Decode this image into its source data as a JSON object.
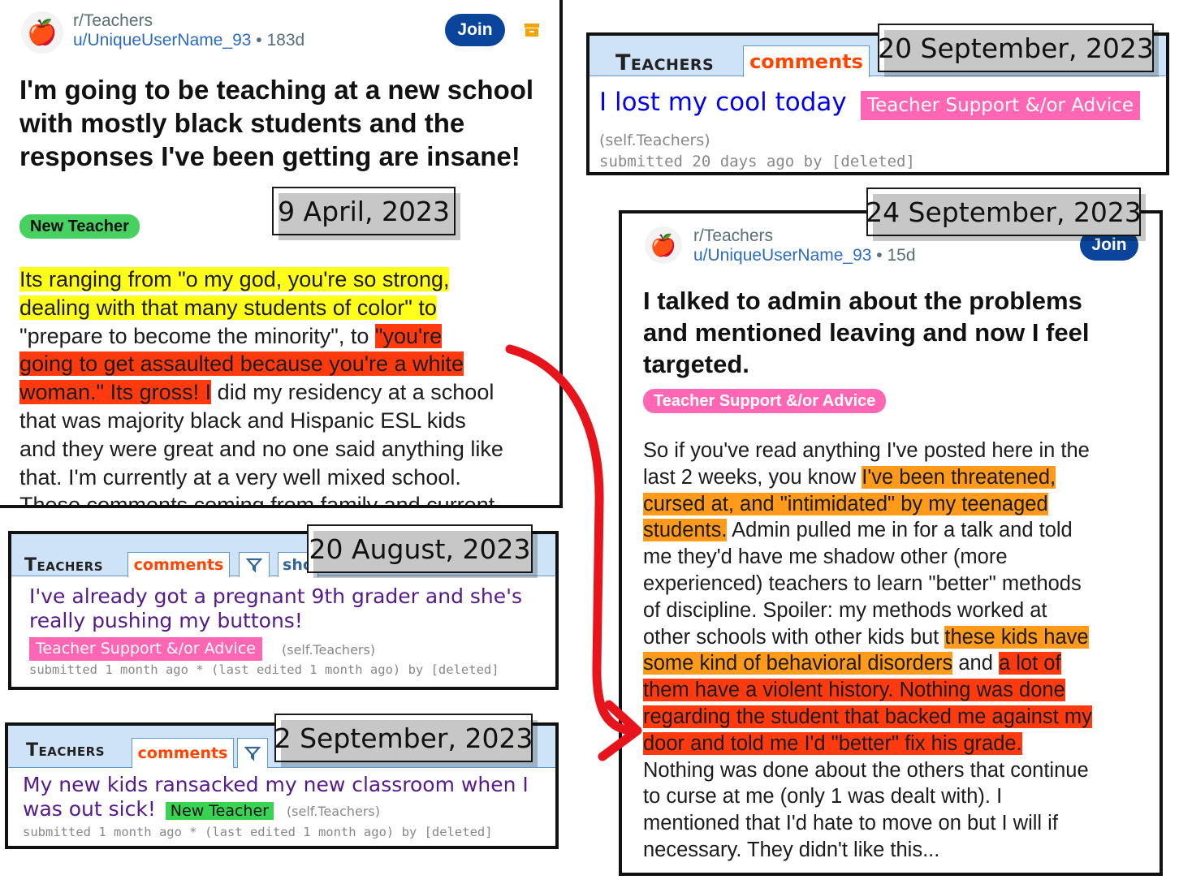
{
  "dates": {
    "d1": "9 April, 2023",
    "d2": "20 September, 2023",
    "d3": "24 September, 2023",
    "d4": "20 August, 2023",
    "d5": "2 September, 2023"
  },
  "post1": {
    "subreddit": "r/Teachers",
    "username": "u/UniqueUserName_93",
    "separator": " • ",
    "age": "183d",
    "join": "Join",
    "title": "I'm going to be teaching at a new school with mostly black students and the responses I've been getting are insane!",
    "flair": "New Teacher",
    "body": {
      "y1": "Its ranging from \"o my god, you're so strong,",
      "y2": "dealing with that many students of color\" to",
      "p3": "\"prepare to become the minority\", to ",
      "r1": "\"you're",
      "r2": "going to get assaulted because you're a white",
      "r3": "woman.\" Its gross! I",
      "p4": " did my residency at a school",
      "p5": "that was majority black and Hispanic ESL kids",
      "p6": "and they were great and no one said anything like",
      "p7": "that. I'm currently at a very well mixed school.",
      "p8": "These comments coming from family and current"
    }
  },
  "post2": {
    "logo": "Teachers",
    "tab": "comments",
    "title": "I lost my cool today",
    "flair": "Teacher Support &/or Advice",
    "domain": "(self.Teachers)",
    "meta": "submitted 20 days ago by [deleted]"
  },
  "post3": {
    "subreddit": "r/Teachers",
    "username": "u/UniqueUserName_93",
    "separator": " • ",
    "age": "15d",
    "join": "Join",
    "title": "I talked to admin about the problems and mentioned leaving and now I feel targeted.",
    "flair": "Teacher Support &/or Advice",
    "body": {
      "l1": "So if you've read anything I've posted here in the",
      "l2a": "last 2 weeks, you know ",
      "l2b": "I've been threatened,",
      "l3": "cursed at, and \"intimidated\" by my teenaged",
      "l4a": "students.",
      "l4b": " Admin pulled me in for a talk and told",
      "l5": "me they'd have me shadow other (more",
      "l6": "experienced) teachers to learn \"better\" methods",
      "l7": "of discipline. Spoiler: my methods worked at",
      "l8a": "other schools with other kids but ",
      "l8b": "these kids have",
      "l9a": "some kind of behavioral disorders",
      "l9b": " and ",
      "l9c": "a lot of",
      "l10": "them have a violent history. Nothing was done",
      "l11": "regarding the student that backed me against my",
      "l12": "door and told me I'd \"better\" fix his grade.",
      "l13": "Nothing was done about the others that continue",
      "l14": "to curse at me (only 1 was dealt with). I",
      "l15": "mentioned that I'd hate to move on but I will if",
      "l16": "necessary. They didn't like this..."
    }
  },
  "post4": {
    "logo": "Teachers",
    "tab": "comments",
    "tab2": "sho",
    "title": "I've already got a pregnant 9th grader and she's really pushing my buttons!",
    "flair": "Teacher Support &/or Advice",
    "domain": "(self.Teachers)",
    "meta": "submitted 1 month ago * (last edited 1 month ago) by [deleted]"
  },
  "post5": {
    "logo": "Teachers",
    "tab": "comments",
    "title_a": "My new kids ransacked my new classroom when I",
    "title_b": "was out sick!",
    "flair": "New Teacher",
    "domain": "(self.Teachers)",
    "meta": "submitted 1 month ago * (last edited 1 month ago) by [deleted]"
  },
  "colors": {
    "highlight_yellow": "#ffff1a",
    "highlight_red": "#ff3a0f",
    "highlight_orange": "#ff9a1a",
    "arrow": "#e8141c",
    "join_blue": "#0a449b",
    "flair_green": "#46d160",
    "flair_pink": "#ff66b3"
  },
  "icons": [
    "apple-icon",
    "archive-icon",
    "filter-icon",
    "arrow-icon"
  ]
}
